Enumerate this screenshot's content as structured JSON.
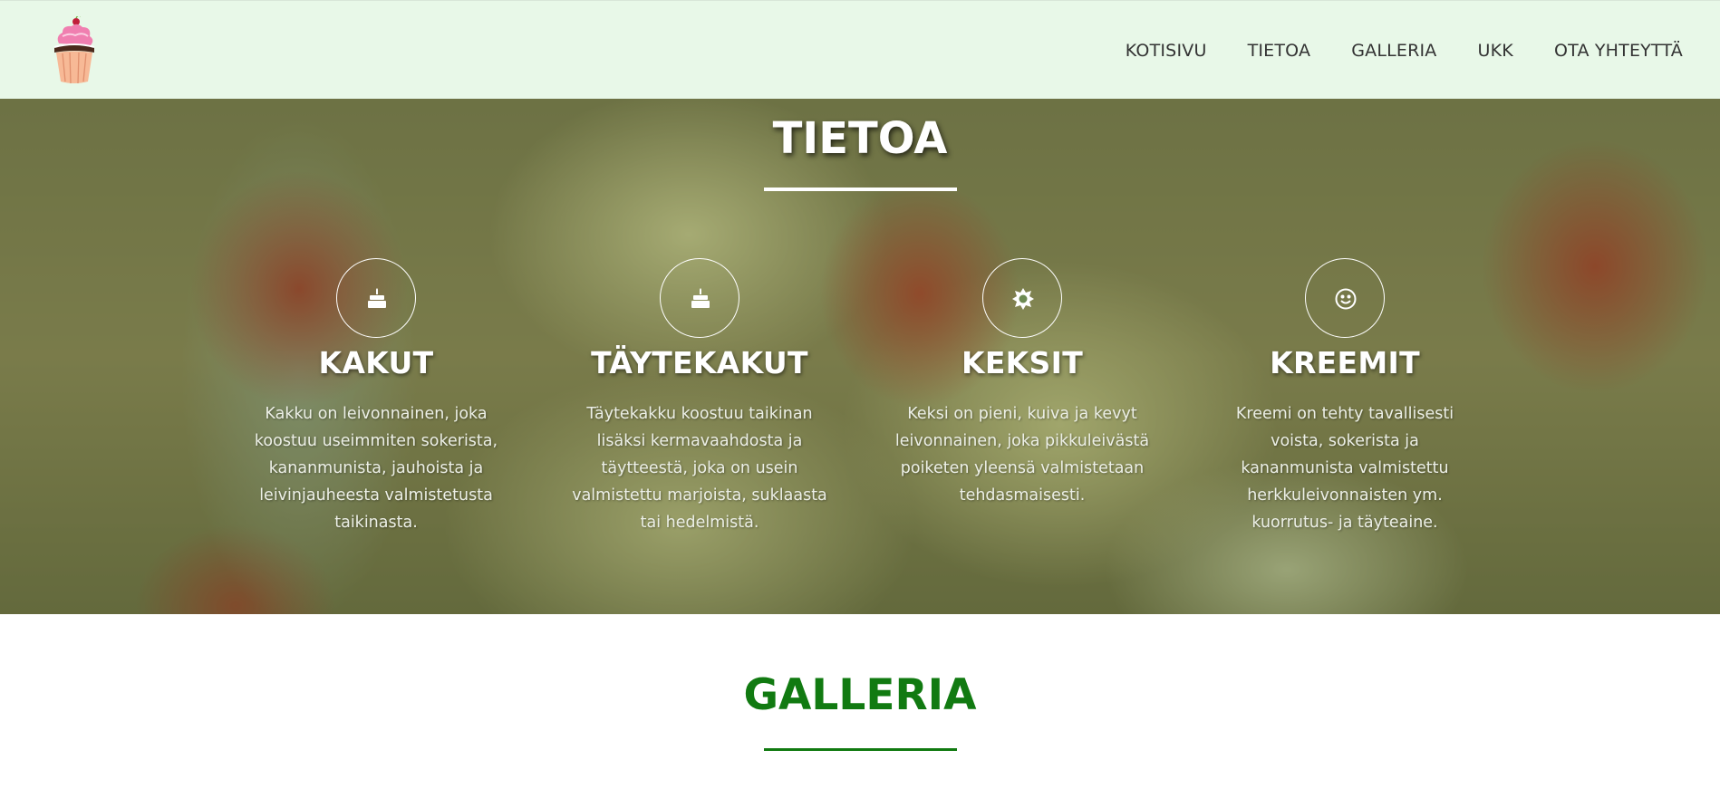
{
  "nav": {
    "logo_icon": "cupcake-icon",
    "links": [
      {
        "label": "KOTISIVU"
      },
      {
        "label": "TIETOA"
      },
      {
        "label": "GALLERIA"
      },
      {
        "label": "UKK"
      },
      {
        "label": "OTA YHTEYTTÄ"
      }
    ]
  },
  "about": {
    "title": "TIETOA",
    "features": [
      {
        "icon": "cake-icon",
        "title": "KAKUT",
        "text": "Kakku on leivonnainen, joka koostuu useimmiten sokerista, kananmunista, jauhoista ja leivinjauheesta valmistetusta taikinasta."
      },
      {
        "icon": "cake-icon",
        "title": "TÄYTEKAKUT",
        "text": "Täytekakku koostuu taikinan lisäksi kermavaahdosta ja täytteestä, joka on usein valmistettu marjoista, suklaasta tai hedelmistä."
      },
      {
        "icon": "sun-icon",
        "title": "KEKSIT",
        "text": "Keksi on pieni, kuiva ja kevyt leivonnainen, joka pikkuleivästä poiketen yleensä valmistetaan tehdasmaisesti."
      },
      {
        "icon": "smile-icon",
        "title": "KREEMIT",
        "text": "Kreemi on tehty tavallisesti voista, sokerista ja kananmunista valmistettu herkkuleivonnaisten ym. kuorrutus- ja täyteaine."
      }
    ]
  },
  "gallery": {
    "title": "GALLERIA"
  },
  "colors": {
    "nav_bg": "#e8f8e8",
    "accent_green": "#117a11",
    "hero_overlay": "#466e2d"
  }
}
